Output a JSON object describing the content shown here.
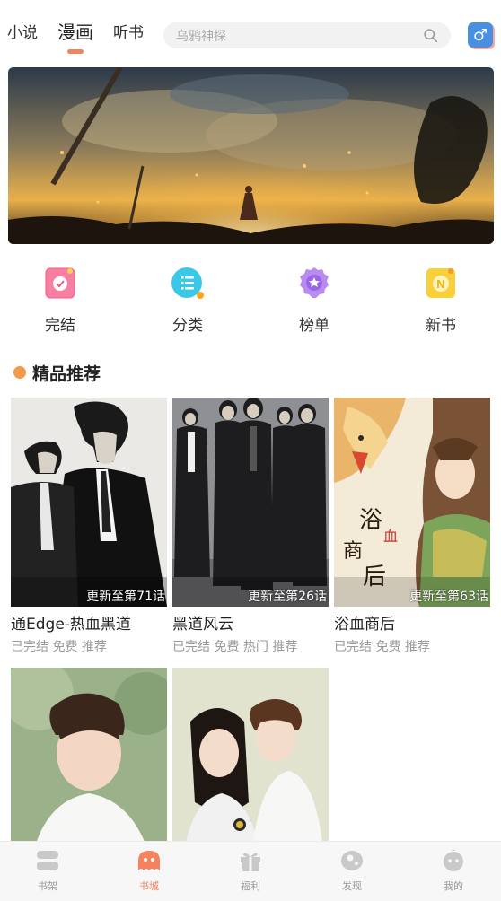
{
  "top_tabs": [
    {
      "label": "小说",
      "active": false
    },
    {
      "label": "漫画",
      "active": true
    },
    {
      "label": "听书",
      "active": false
    }
  ],
  "search": {
    "placeholder": "乌鸦神探",
    "icon": "search-icon"
  },
  "gender_toggle": {
    "symbol": "♂",
    "color": "#4a90e2"
  },
  "quick_nav": [
    {
      "label": "完结",
      "icon": "completed-book-icon"
    },
    {
      "label": "分类",
      "icon": "category-list-icon"
    },
    {
      "label": "榜单",
      "icon": "ranking-badge-icon"
    },
    {
      "label": "新书",
      "icon": "new-book-icon"
    }
  ],
  "section": {
    "title": "精品推荐"
  },
  "comics": [
    {
      "title": "通Edge-热血黑道",
      "update": "更新至第71话",
      "tags": "已完结 免费 推荐"
    },
    {
      "title": "黑道风云",
      "update": "更新至第26话",
      "tags": "已完结 免费 热门 推荐"
    },
    {
      "title": "浴血商后",
      "update": "更新至第63话",
      "tags": "已完结 免费 推荐"
    },
    {
      "title": "",
      "update": "",
      "tags": ""
    },
    {
      "title": "",
      "update": "",
      "tags": ""
    }
  ],
  "bottom_nav": [
    {
      "label": "书架",
      "icon": "bookshelf-icon",
      "active": false
    },
    {
      "label": "书城",
      "icon": "bookstore-icon",
      "active": true
    },
    {
      "label": "福利",
      "icon": "gift-icon",
      "active": false
    },
    {
      "label": "发现",
      "icon": "discover-icon",
      "active": false
    },
    {
      "label": "我的",
      "icon": "profile-icon",
      "active": false
    }
  ],
  "colors": {
    "accent": "#f5825f",
    "search_bg": "#f2f2f2",
    "gray_text": "#999999"
  }
}
